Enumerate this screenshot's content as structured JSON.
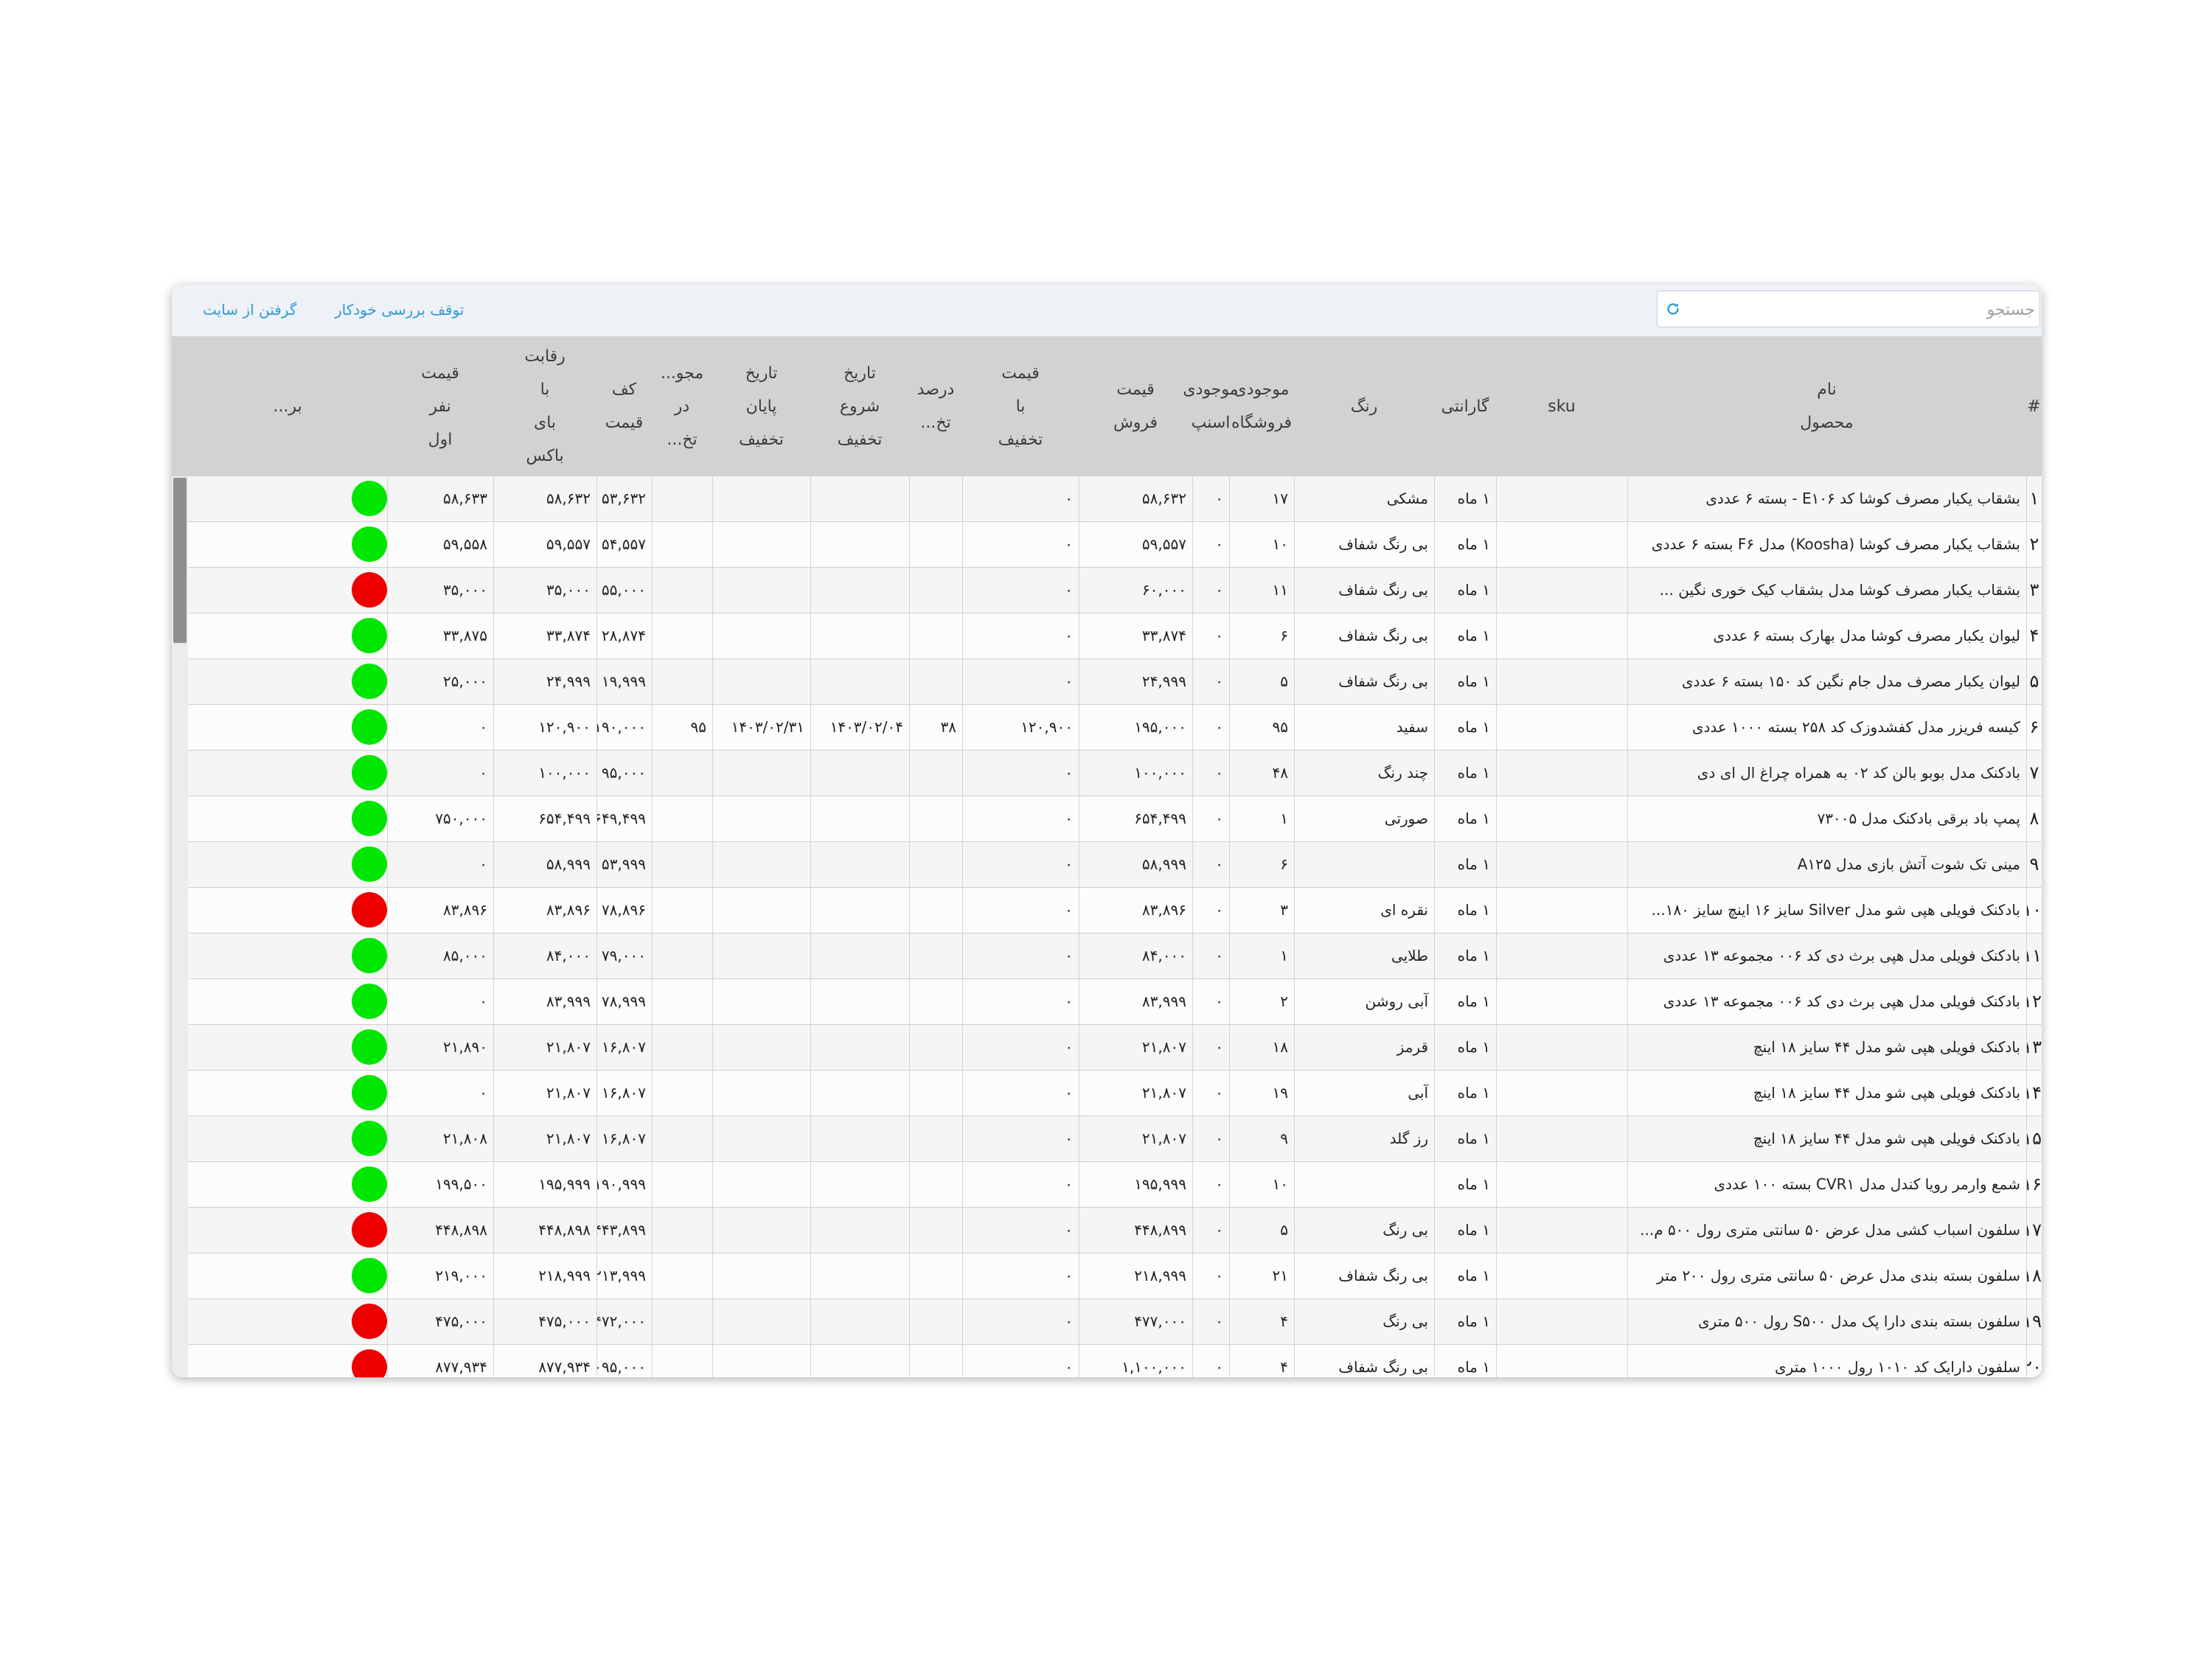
{
  "toolbar": {
    "fetch_label": "گرفتن از سایت",
    "stop_label": "توقف بررسی خودکار",
    "search_placeholder": "جستجو",
    "refresh_icon": "refresh-icon"
  },
  "columns": [
    {
      "key": "num",
      "label": "#"
    },
    {
      "key": "name",
      "label": "نام\nمحصول"
    },
    {
      "key": "sku",
      "label": "sku"
    },
    {
      "key": "warranty",
      "label": "گارانتی"
    },
    {
      "key": "color",
      "label": "رنگ"
    },
    {
      "key": "store_stock",
      "label": "موجودی\nفروشگاه"
    },
    {
      "key": "snapp_stock",
      "label": "موجودی\nاسنپ"
    },
    {
      "key": "sale_price",
      "label": "قیمت\nفروش"
    },
    {
      "key": "discount_price",
      "label": "قیمت\nبا\nتخفیف"
    },
    {
      "key": "discount_pct",
      "label": "درصد\nتخ..."
    },
    {
      "key": "start_date",
      "label": "تاریخ\nشروع\nتخفیف"
    },
    {
      "key": "end_date",
      "label": "تاریخ\nپایان\nتخفیف"
    },
    {
      "key": "stock_in_disc",
      "label": "مجو...\nدر\nتخ..."
    },
    {
      "key": "floor_price",
      "label": "کف\nقیمت"
    },
    {
      "key": "competition",
      "label": "رقابت\nبا\nبای\nباکس"
    },
    {
      "key": "first_price",
      "label": "قیمت\nنفر\nاول"
    },
    {
      "key": "status",
      "label": "بر..."
    }
  ],
  "rows": [
    {
      "num": "۱",
      "name": "بشقاب یکبار مصرف کوشا کد E۱۰۶ - بسته ۶ عددی",
      "sku": "",
      "warranty": "۱ ماه",
      "color": "مشکی",
      "store_stock": "۱۷",
      "snapp_stock": "۰",
      "sale_price": "۵۸,۶۳۲",
      "discount_price": "۰",
      "discount_pct": "",
      "start_date": "",
      "end_date": "",
      "stock_in_disc": "",
      "floor_price": "۵۳,۶۳۲",
      "competition": "۵۸,۶۳۲",
      "first_price": "۵۸,۶۳۳",
      "status": "green"
    },
    {
      "num": "۲",
      "name": "بشقاب یکبار مصرف کوشا (Koosha) مدل F۶ بسته ۶ عددی",
      "sku": "",
      "warranty": "۱ ماه",
      "color": "بی رنگ شفاف",
      "store_stock": "۱۰",
      "snapp_stock": "۰",
      "sale_price": "۵۹,۵۵۷",
      "discount_price": "۰",
      "discount_pct": "",
      "start_date": "",
      "end_date": "",
      "stock_in_disc": "",
      "floor_price": "۵۴,۵۵۷",
      "competition": "۵۹,۵۵۷",
      "first_price": "۵۹,۵۵۸",
      "status": "green"
    },
    {
      "num": "۳",
      "name": "بشقاب یکبار مصرف کوشا مدل بشقاب کیک خوری نگین ...",
      "sku": "",
      "warranty": "۱ ماه",
      "color": "بی رنگ شفاف",
      "store_stock": "۱۱",
      "snapp_stock": "۰",
      "sale_price": "۶۰,۰۰۰",
      "discount_price": "۰",
      "discount_pct": "",
      "start_date": "",
      "end_date": "",
      "stock_in_disc": "",
      "floor_price": "۵۵,۰۰۰",
      "competition": "۳۵,۰۰۰",
      "first_price": "۳۵,۰۰۰",
      "status": "red"
    },
    {
      "num": "۴",
      "name": "لیوان یکبار مصرف کوشا مدل بهارک بسته ۶ عددی",
      "sku": "",
      "warranty": "۱ ماه",
      "color": "بی رنگ شفاف",
      "store_stock": "۶",
      "snapp_stock": "۰",
      "sale_price": "۳۳,۸۷۴",
      "discount_price": "۰",
      "discount_pct": "",
      "start_date": "",
      "end_date": "",
      "stock_in_disc": "",
      "floor_price": "۲۸,۸۷۴",
      "competition": "۳۳,۸۷۴",
      "first_price": "۳۳,۸۷۵",
      "status": "green"
    },
    {
      "num": "۵",
      "name": "لیوان یکبار مصرف مدل جام نگین کد ۱۵۰ بسته ۶ عددی",
      "sku": "",
      "warranty": "۱ ماه",
      "color": "بی رنگ شفاف",
      "store_stock": "۵",
      "snapp_stock": "۰",
      "sale_price": "۲۴,۹۹۹",
      "discount_price": "۰",
      "discount_pct": "",
      "start_date": "",
      "end_date": "",
      "stock_in_disc": "",
      "floor_price": "۱۹,۹۹۹",
      "competition": "۲۴,۹۹۹",
      "first_price": "۲۵,۰۰۰",
      "status": "green"
    },
    {
      "num": "۶",
      "name": "کیسه فریزر مدل کفشدوزک کد ۲۵۸ بسته ۱۰۰۰ عددی",
      "sku": "",
      "warranty": "۱ ماه",
      "color": "سفید",
      "store_stock": "۹۵",
      "snapp_stock": "۰",
      "sale_price": "۱۹۵,۰۰۰",
      "discount_price": "۱۲۰,۹۰۰",
      "discount_pct": "۳۸",
      "start_date": "۱۴۰۳/۰۲/۰۴",
      "end_date": "۱۴۰۳/۰۲/۳۱",
      "stock_in_disc": "۹۵",
      "floor_price": "۱۹۰,۰۰۰",
      "competition": "۱۲۰,۹۰۰",
      "first_price": "۰",
      "status": "green"
    },
    {
      "num": "۷",
      "name": "بادکنک مدل بوبو بالن کد ۰۲ به همراه چراغ ال ای دی",
      "sku": "",
      "warranty": "۱ ماه",
      "color": "چند رنگ",
      "store_stock": "۴۸",
      "snapp_stock": "۰",
      "sale_price": "۱۰۰,۰۰۰",
      "discount_price": "۰",
      "discount_pct": "",
      "start_date": "",
      "end_date": "",
      "stock_in_disc": "",
      "floor_price": "۹۵,۰۰۰",
      "competition": "۱۰۰,۰۰۰",
      "first_price": "۰",
      "status": "green"
    },
    {
      "num": "۸",
      "name": "پمپ باد برقی بادکنک مدل ۷۳۰۰۵",
      "sku": "",
      "warranty": "۱ ماه",
      "color": "صورتی",
      "store_stock": "۱",
      "snapp_stock": "۰",
      "sale_price": "۶۵۴,۴۹۹",
      "discount_price": "۰",
      "discount_pct": "",
      "start_date": "",
      "end_date": "",
      "stock_in_disc": "",
      "floor_price": "۶۴۹,۴۹۹",
      "competition": "۶۵۴,۴۹۹",
      "first_price": "۷۵۰,۰۰۰",
      "status": "green"
    },
    {
      "num": "۹",
      "name": "مینی تک شوت آتش بازی مدل A۱۲۵",
      "sku": "",
      "warranty": "۱ ماه",
      "color": "",
      "store_stock": "۶",
      "snapp_stock": "۰",
      "sale_price": "۵۸,۹۹۹",
      "discount_price": "۰",
      "discount_pct": "",
      "start_date": "",
      "end_date": "",
      "stock_in_disc": "",
      "floor_price": "۵۳,۹۹۹",
      "competition": "۵۸,۹۹۹",
      "first_price": "۰",
      "status": "green"
    },
    {
      "num": "۱۰",
      "name": "بادکنک فویلی هپی شو مدل Silver سایز ۱۶ اینچ سایز ۱۸۰...",
      "sku": "",
      "warranty": "۱ ماه",
      "color": "نقره ای",
      "store_stock": "۳",
      "snapp_stock": "۰",
      "sale_price": "۸۳,۸۹۶",
      "discount_price": "۰",
      "discount_pct": "",
      "start_date": "",
      "end_date": "",
      "stock_in_disc": "",
      "floor_price": "۷۸,۸۹۶",
      "competition": "۸۳,۸۹۶",
      "first_price": "۸۳,۸۹۶",
      "status": "red"
    },
    {
      "num": "۱۱",
      "name": "بادکنک فویلی مدل هپی برث دی کد ۰۰۶ مجموعه ۱۳ عددی",
      "sku": "",
      "warranty": "۱ ماه",
      "color": "طلایی",
      "store_stock": "۱",
      "snapp_stock": "۰",
      "sale_price": "۸۴,۰۰۰",
      "discount_price": "۰",
      "discount_pct": "",
      "start_date": "",
      "end_date": "",
      "stock_in_disc": "",
      "floor_price": "۷۹,۰۰۰",
      "competition": "۸۴,۰۰۰",
      "first_price": "۸۵,۰۰۰",
      "status": "green"
    },
    {
      "num": "۱۲",
      "name": "بادکنک فویلی مدل هپی برث دی کد ۰۰۶ مجموعه ۱۳ عددی",
      "sku": "",
      "warranty": "۱ ماه",
      "color": "آبی روشن",
      "store_stock": "۲",
      "snapp_stock": "۰",
      "sale_price": "۸۳,۹۹۹",
      "discount_price": "۰",
      "discount_pct": "",
      "start_date": "",
      "end_date": "",
      "stock_in_disc": "",
      "floor_price": "۷۸,۹۹۹",
      "competition": "۸۳,۹۹۹",
      "first_price": "۰",
      "status": "green"
    },
    {
      "num": "۱۳",
      "name": "بادکنک فویلی هپی شو مدل ۴۴ سایز ۱۸ اینچ",
      "sku": "",
      "warranty": "۱ ماه",
      "color": "قرمز",
      "store_stock": "۱۸",
      "snapp_stock": "۰",
      "sale_price": "۲۱,۸۰۷",
      "discount_price": "۰",
      "discount_pct": "",
      "start_date": "",
      "end_date": "",
      "stock_in_disc": "",
      "floor_price": "۱۶,۸۰۷",
      "competition": "۲۱,۸۰۷",
      "first_price": "۲۱,۸۹۰",
      "status": "green"
    },
    {
      "num": "۱۴",
      "name": "بادکنک فویلی هپی شو مدل ۴۴ سایز ۱۸ اینچ",
      "sku": "",
      "warranty": "۱ ماه",
      "color": "آبی",
      "store_stock": "۱۹",
      "snapp_stock": "۰",
      "sale_price": "۲۱,۸۰۷",
      "discount_price": "۰",
      "discount_pct": "",
      "start_date": "",
      "end_date": "",
      "stock_in_disc": "",
      "floor_price": "۱۶,۸۰۷",
      "competition": "۲۱,۸۰۷",
      "first_price": "۰",
      "status": "green"
    },
    {
      "num": "۱۵",
      "name": "بادکنک فویلی هپی شو مدل ۴۴ سایز ۱۸ اینچ",
      "sku": "",
      "warranty": "۱ ماه",
      "color": "رز گلد",
      "store_stock": "۹",
      "snapp_stock": "۰",
      "sale_price": "۲۱,۸۰۷",
      "discount_price": "۰",
      "discount_pct": "",
      "start_date": "",
      "end_date": "",
      "stock_in_disc": "",
      "floor_price": "۱۶,۸۰۷",
      "competition": "۲۱,۸۰۷",
      "first_price": "۲۱,۸۰۸",
      "status": "green"
    },
    {
      "num": "۱۶",
      "name": "شمع وارمر رویا کندل مدل CVR۱ بسته ۱۰۰ عددی",
      "sku": "",
      "warranty": "۱ ماه",
      "color": "",
      "store_stock": "۱۰",
      "snapp_stock": "۰",
      "sale_price": "۱۹۵,۹۹۹",
      "discount_price": "۰",
      "discount_pct": "",
      "start_date": "",
      "end_date": "",
      "stock_in_disc": "",
      "floor_price": "۱۹۰,۹۹۹",
      "competition": "۱۹۵,۹۹۹",
      "first_price": "۱۹۹,۵۰۰",
      "status": "green"
    },
    {
      "num": "۱۷",
      "name": "سلفون اسباب کشی مدل عرض ۵۰ سانتی متری رول ۵۰۰ م...",
      "sku": "",
      "warranty": "۱ ماه",
      "color": "بی رنگ",
      "store_stock": "۵",
      "snapp_stock": "۰",
      "sale_price": "۴۴۸,۸۹۹",
      "discount_price": "۰",
      "discount_pct": "",
      "start_date": "",
      "end_date": "",
      "stock_in_disc": "",
      "floor_price": "۴۴۳,۸۹۹",
      "competition": "۴۴۸,۸۹۸",
      "first_price": "۴۴۸,۸۹۸",
      "status": "red"
    },
    {
      "num": "۱۸",
      "name": "سلفون بسته بندی مدل عرض ۵۰ سانتی متری رول ۲۰۰ متر",
      "sku": "",
      "warranty": "۱ ماه",
      "color": "بی رنگ شفاف",
      "store_stock": "۲۱",
      "snapp_stock": "۰",
      "sale_price": "۲۱۸,۹۹۹",
      "discount_price": "۰",
      "discount_pct": "",
      "start_date": "",
      "end_date": "",
      "stock_in_disc": "",
      "floor_price": "۲۱۳,۹۹۹",
      "competition": "۲۱۸,۹۹۹",
      "first_price": "۲۱۹,۰۰۰",
      "status": "green"
    },
    {
      "num": "۱۹",
      "name": "سلفون بسته بندی دارا پک مدل S۵۰۰ رول ۵۰۰ متری",
      "sku": "",
      "warranty": "۱ ماه",
      "color": "بی رنگ",
      "store_stock": "۴",
      "snapp_stock": "۰",
      "sale_price": "۴۷۷,۰۰۰",
      "discount_price": "۰",
      "discount_pct": "",
      "start_date": "",
      "end_date": "",
      "stock_in_disc": "",
      "floor_price": "۴۷۲,۰۰۰",
      "competition": "۴۷۵,۰۰۰",
      "first_price": "۴۷۵,۰۰۰",
      "status": "red"
    },
    {
      "num": "۲۰",
      "name": "سلفون دارایک کد ۱۰۱۰ رول ۱۰۰۰ متری",
      "sku": "",
      "warranty": "۱ ماه",
      "color": "بی رنگ شفاف",
      "store_stock": "۴",
      "snapp_stock": "۰",
      "sale_price": "۱,۱۰۰,۰۰۰",
      "discount_price": "۰",
      "discount_pct": "",
      "start_date": "",
      "end_date": "",
      "stock_in_disc": "",
      "floor_price": "۱,۰۹۵,۰۰۰",
      "competition": "۸۷۷,۹۳۴",
      "first_price": "۸۷۷,۹۳۴",
      "status": "red"
    }
  ],
  "status_colors": {
    "green": "#00e600",
    "red": "#ee0000"
  }
}
